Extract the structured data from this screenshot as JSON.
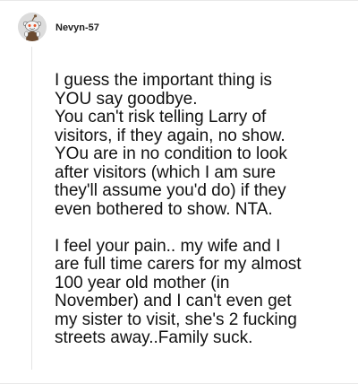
{
  "comment": {
    "author": "Nevyn-57",
    "avatar_icon": "reddit-snoo-avatar-icon",
    "paragraphs": [
      [
        "I guess the important thing is",
        "YOU say goodbye.",
        "You can't risk telling Larry of",
        "visitors, if they again, no show.",
        "YOu are in no condition to look",
        "after visitors (which I am sure",
        "they'll assume you'd do) if they",
        "even bothered to show. NTA."
      ],
      [
        "I feel your pain.. my wife and I",
        "are full time carers for my almost",
        "100 year old mother (in",
        "November) and I can't even get",
        "my sister to visit, she's 2 fucking",
        "streets away..Family suck."
      ]
    ]
  }
}
